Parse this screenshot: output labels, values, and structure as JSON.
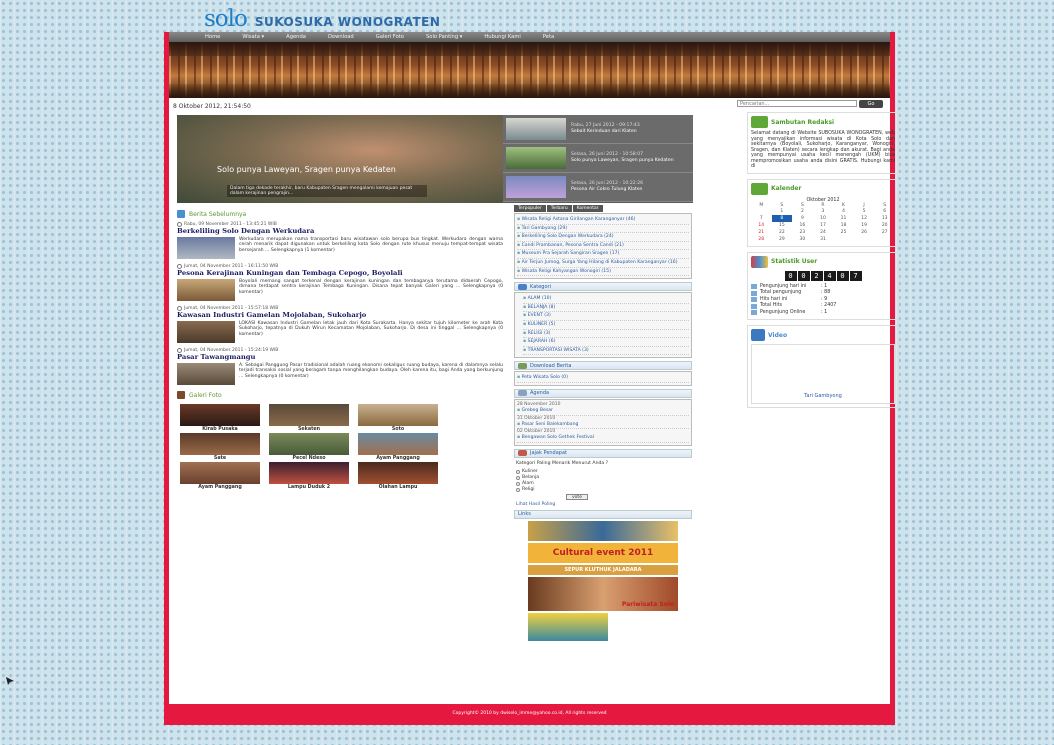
{
  "header": {
    "logo_text": "solo",
    "tagline": "SUKOSUKA WONOGRATEN"
  },
  "nav": {
    "items": [
      "Home",
      "Wisata ▾",
      "Agenda",
      "Download",
      "Galeri Foto",
      "Solo Panting ▾",
      "Hubungi Kami",
      "Peta"
    ]
  },
  "date": "8 Oktober 2012, 21:54:50",
  "search": {
    "placeholder": "Pencarian...",
    "button": "Go"
  },
  "slider": {
    "caption": "Solo punya Laweyan, Sragen punya Kedaten",
    "caption_small": "Dalam tiga dekade terakhir, baru Kabupaten Sragen mengalami kemajuan pesat dalam kerajinan pengrajin...",
    "items": [
      {
        "date": "Rabu, 27 Juni 2012 - 09:17:43",
        "title": "Sebait Kerinduan dari Klaten"
      },
      {
        "date": "Selasa, 26 Juni 2012 - 10:58:07",
        "title": "Solo punya Laweyan, Sragen punya Kedaten"
      },
      {
        "date": "Selasa, 26 Juni 2012 - 10:22:26",
        "title": "Pesona Air Cokro Tulung Klaten"
      }
    ]
  },
  "berita": {
    "heading": "Berita Sebelumnya",
    "posts": [
      {
        "meta": "Rabu, 09 November 2011 - 13:45:21 WIB",
        "title": "Berkeliling Solo Dengan Werkudara",
        "text": "Werkudara merupakan nama transportasi baru wisatawan solo berupa bus tingkat. Werkudara dengan warna cerah menarik dapat digunakan untuk berkeliling kota Solo dengan rute khusus menuju tempat-tempat wisata bersejarah ... Selengkapnya (1 komentar)"
      },
      {
        "meta": "Jumat, 04 November 2011 - 16:11:50 WIB",
        "title": "Pesona Kerajinan Kuningan dan Tembaga Cepogo, Boyolali",
        "text": "Boyolali memang sangat terkenal dengan kerajinan kuningan dan tembaganya terutama didaerah Cepogo, dimana terdapat sentra kerajinan Tembaga Kuningan. Disana tepat banyak Galeri yang ... Selengkapnya (0 komentar)"
      },
      {
        "meta": "Jumat, 04 November 2011 - 15:57:18 WIB",
        "title": "Kawasan Industri Gamelan Mojolaban, Sukoharjo",
        "text": "LOKASI Kawasan Industri Gamelan letak jauh dari Kota Surakarta. Hanya sekitar tujuh kilometer ke arah Kota Sukoharjo, tepatnya di Dukuh Wirun Kecamatan Mojolaban, Sukoharjo. Di desa ini tinggal ... Selengkapnya (0 komentar)"
      },
      {
        "meta": "Jumat, 04 November 2011 - 15:24:19 WIB",
        "title": "Pasar Tawangmangu",
        "text": "A. Sebagai Panggung Pasar tradisional adalah ruang ekonomi sekaligus ruang budaya, karena di dalamnya selalu terjadi transaksi sosial yang beragam tanpa menghilangkan budaya. Oleh karena itu, bagi Anda yang berkunjung ... Selengkapnya (0 komentar)"
      }
    ]
  },
  "galeri": {
    "heading": "Galeri Foto",
    "items": [
      "Kirab Pusaka",
      "Sekaten",
      "Soto",
      "Sate",
      "Pecel Ndeso",
      "Ayam Panggang",
      "Ayam Panggang",
      "Lampu Duduk 2",
      "Olahan Lampu"
    ]
  },
  "tabs": [
    "Terpopuler",
    "Terbaru",
    "Komentar"
  ],
  "populer": [
    "Wisata Religi Astana Girilangan Karanganyar (46)",
    "Tari Gambyong (29)",
    "Berkeliling Solo Dengan Werkudara (24)",
    "Candi Prambanan, Pesona Sentra Candi (21)",
    "Museum Pra Sejarah Sangiran Sragen (17)",
    "Air Terjun Jumog, Surga Yang Hilang di Kabupaten Karanganyar (16)",
    "Wisata Religi Kahyangan Wonogiri (15)"
  ],
  "kategori": {
    "heading": "Kategori",
    "items": [
      "ALAM (10)",
      "BELANJA (8)",
      "EVENT (3)",
      "KULINER (5)",
      "RELIGI (3)",
      "SEJARAH (6)",
      "TRANSPORTASI WISATA (3)"
    ]
  },
  "download": {
    "heading": "Download Berita",
    "item": "Peta Wisata Solo (0)"
  },
  "agenda": {
    "heading": "Agenda",
    "items": [
      {
        "date": "28 November 2010",
        "title": "Grebeg Besar"
      },
      {
        "date": "31 Oktober 2010",
        "title": "Pasar Seni Balekambang"
      },
      {
        "date": "02 Oktober 2010",
        "title": "Bengawan Solo Gethek Festival"
      }
    ]
  },
  "poll": {
    "heading": "Jajak Pendapat",
    "question": "Kategori Paling Menarik Menurut Anda ?",
    "options": [
      "Kuliner",
      "Belanja",
      "Alam",
      "Religi"
    ],
    "button": "vote",
    "result_link": "Lihat Hasil Poling"
  },
  "links": {
    "heading": "Links",
    "banner_text": [
      "Cultural event 2011",
      "SEPUR KLUTHUK JALADARA",
      "Pariwisata Solo"
    ]
  },
  "sambutan": {
    "heading": "Sambutan Redaksi",
    "text": "Selamat datang di Website SUBOSUKA WONOGRATEN, web yang menyajikan informasi wisata di Kota Solo dan sekitarnya (Boyolali, Sukoharjo, Karanganyar, Wonogiri, Sragen, dan Klaten) secara lengkap dan akurat. Bagi anda yang mempunyai usaha kecil menengah (UKM) bisa mempromosikan usaha anda disini GRATIS. Hubungi kami di"
  },
  "kalender": {
    "heading": "Kalender",
    "month": "Oktober 2012",
    "days": [
      "M",
      "S",
      "S",
      "R",
      "K",
      "J",
      "S"
    ],
    "weeks": [
      [
        "",
        "1",
        "2",
        "3",
        "4",
        "5",
        "6"
      ],
      [
        "7",
        "8",
        "9",
        "10",
        "11",
        "12",
        "13"
      ],
      [
        "14",
        "15",
        "16",
        "17",
        "18",
        "19",
        "20"
      ],
      [
        "21",
        "22",
        "23",
        "24",
        "25",
        "26",
        "27"
      ],
      [
        "28",
        "29",
        "30",
        "31",
        "",
        "",
        ""
      ]
    ]
  },
  "statistik": {
    "heading": "Statistik User",
    "digits": [
      "0",
      "0",
      "2",
      "4",
      "0",
      "7"
    ],
    "rows": [
      {
        "label": "Pengunjung hari ini",
        "value": ": 1"
      },
      {
        "label": "Total pengunjung",
        "value": ": 88"
      },
      {
        "label": "Hits hari ini",
        "value": ": 9"
      },
      {
        "label": "Total Hits",
        "value": ": 2407"
      },
      {
        "label": "Pengunjung Online",
        "value": ": 1"
      }
    ]
  },
  "video": {
    "heading": "Video",
    "caption": "Tari Gambyong"
  },
  "footer": "Copyright© 2010 by dwiselo_imme@yahoo.co.id, All rights reserved"
}
